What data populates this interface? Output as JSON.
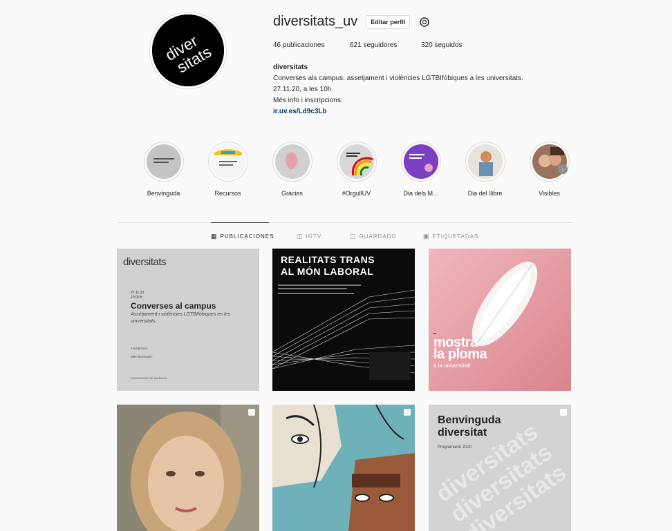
{
  "profile": {
    "username": "diversitats_uv",
    "edit_label": "Editar perfil",
    "stats": {
      "posts": "46 publicaciones",
      "followers": "621 seguidores",
      "following": "320 seguidos"
    },
    "avatar_text": [
      "diver",
      "sitats"
    ],
    "bio": {
      "name": "diversitats",
      "line1": "Converses als campus: assetjament i violències LGTBIfòbiques a les universitats.",
      "line2": "27.11.20, a les 10h.",
      "line3": "Més info i inscripcions:",
      "link": "ir.uv.es/Ld9c3Lb"
    }
  },
  "highlights": [
    {
      "label": "Benvinguda",
      "icon": "highlight-benvinguda"
    },
    {
      "label": "Recursos",
      "icon": "highlight-recursos"
    },
    {
      "label": "Gràcies",
      "icon": "highlight-gracies"
    },
    {
      "label": "#OrgullUV",
      "icon": "highlight-orgull"
    },
    {
      "label": "Dia dels M...",
      "icon": "highlight-dia-dels-m"
    },
    {
      "label": "Dia del llibre",
      "icon": "highlight-dia-del-llibre"
    },
    {
      "label": "Visibles",
      "icon": "highlight-visibles"
    }
  ],
  "tabs": [
    {
      "label": "PUBLICACIONES",
      "icon": "grid-icon",
      "active": true
    },
    {
      "label": "IGTV",
      "icon": "igtv-icon",
      "active": false
    },
    {
      "label": "GUARDADO",
      "icon": "bookmark-icon",
      "active": false
    },
    {
      "label": "ETIQUETADAS",
      "icon": "tag-icon",
      "active": false
    }
  ],
  "posts": {
    "p1": {
      "brand": "diversitats",
      "date": "27.11.20",
      "time": "10:00 h",
      "title": "Converses al campus",
      "subtitle": "Assetjament i violències LGTBIfòbiques en les universitats",
      "inscripcions": "Inscripcions:",
      "more_info": "Més informació:",
      "university": "VNIVERSITAT DE VALÈNCIA"
    },
    "p2": {
      "title_line1": "REALITATS TRANS",
      "title_line2": "AL MÓN LABORAL"
    },
    "p3": {
      "title_line1": "mostra",
      "title_line2": "la ploma",
      "subtitle": "a la universitat!"
    },
    "p6": {
      "title_line1": "Benvinguda",
      "title_line2": "diversitat",
      "subtitle": "Programació 2020",
      "bg_text": "diversitats"
    }
  },
  "colors": {
    "link": "#00376b",
    "divider": "#dbdbdb",
    "muted": "#8e8e8e"
  }
}
